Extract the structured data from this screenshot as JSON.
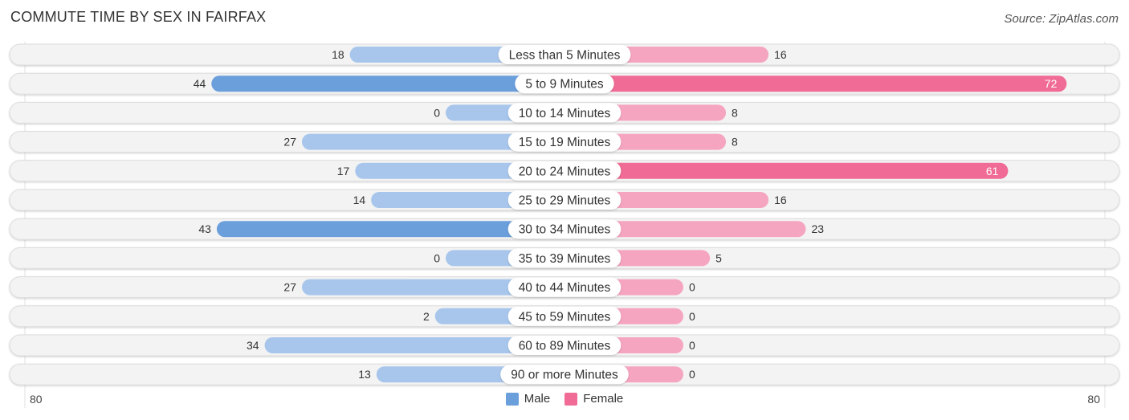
{
  "header": {
    "title": "COMMUTE TIME BY SEX IN FAIRFAX",
    "source": "Source: ZipAtlas.com"
  },
  "axis": {
    "left_label": "80",
    "right_label": "80"
  },
  "legend": [
    {
      "name": "Male",
      "color": "#6a9fdc"
    },
    {
      "name": "Female",
      "color": "#f06b95"
    }
  ],
  "colors": {
    "male_strong": "#6a9fdc",
    "male_light": "#a8c6ec",
    "female_strong": "#f06b95",
    "female_light": "#f5a5bf",
    "track": "#f3f3f3",
    "track_border": "#dcdcdc"
  },
  "chart_data": {
    "type": "bar",
    "orientation": "horizontal-diverging",
    "title": "COMMUTE TIME BY SEX IN FAIRFAX",
    "xlabel": "",
    "ylabel": "",
    "xlim": [
      -80,
      80
    ],
    "grid": false,
    "legend_position": "bottom-center",
    "categories": [
      "Less than 5 Minutes",
      "5 to 9 Minutes",
      "10 to 14 Minutes",
      "15 to 19 Minutes",
      "20 to 24 Minutes",
      "25 to 29 Minutes",
      "30 to 34 Minutes",
      "35 to 39 Minutes",
      "40 to 44 Minutes",
      "45 to 59 Minutes",
      "60 to 89 Minutes",
      "90 or more Minutes"
    ],
    "series": [
      {
        "name": "Male",
        "side": "left",
        "values": [
          18,
          44,
          0,
          27,
          17,
          14,
          43,
          0,
          27,
          2,
          34,
          13
        ]
      },
      {
        "name": "Female",
        "side": "right",
        "values": [
          16,
          72,
          8,
          8,
          61,
          16,
          23,
          5,
          0,
          0,
          0,
          0
        ]
      }
    ]
  }
}
